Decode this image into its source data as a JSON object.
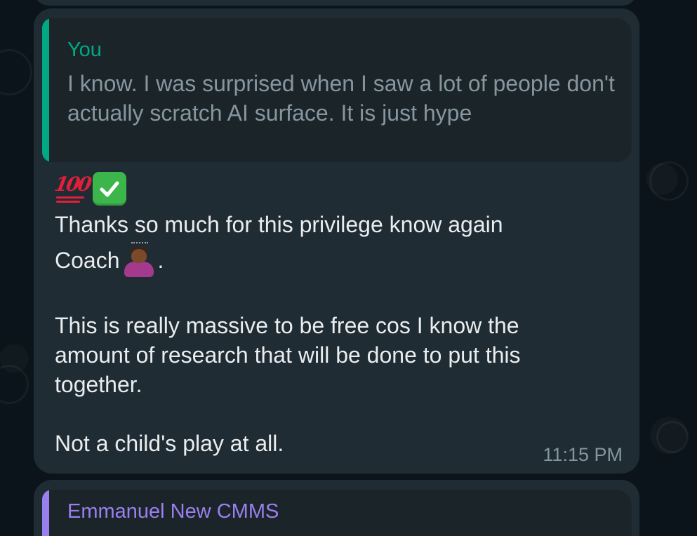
{
  "message": {
    "quote": {
      "author": "You",
      "text": "I know. I was surprised when I saw a lot of people don't actually scratch AI surface. It is just hype",
      "accent_color": "#00a884"
    },
    "emoji_row": [
      "hundred-points-icon",
      "check-mark-button-icon"
    ],
    "line1": "Thanks so much for this privilege know again",
    "line2_before": "Coach",
    "line2_emoji": "person-bowing-icon",
    "line2_after": ".",
    "paragraph2": "This is really massive to be free cos I know the amount of research that will be done to put this together.",
    "paragraph3": "Not a child's play at all.",
    "timestamp": "11:15 PM"
  },
  "next_message": {
    "quote_author": "Emmanuel New CMMS",
    "accent_color": "#9a7ff0"
  },
  "colors": {
    "chat_background": "#0b141a",
    "bubble": "#202c33",
    "quote_background": "#1b2529",
    "primary_text": "#e9edef",
    "secondary_text": "#8696a0"
  }
}
